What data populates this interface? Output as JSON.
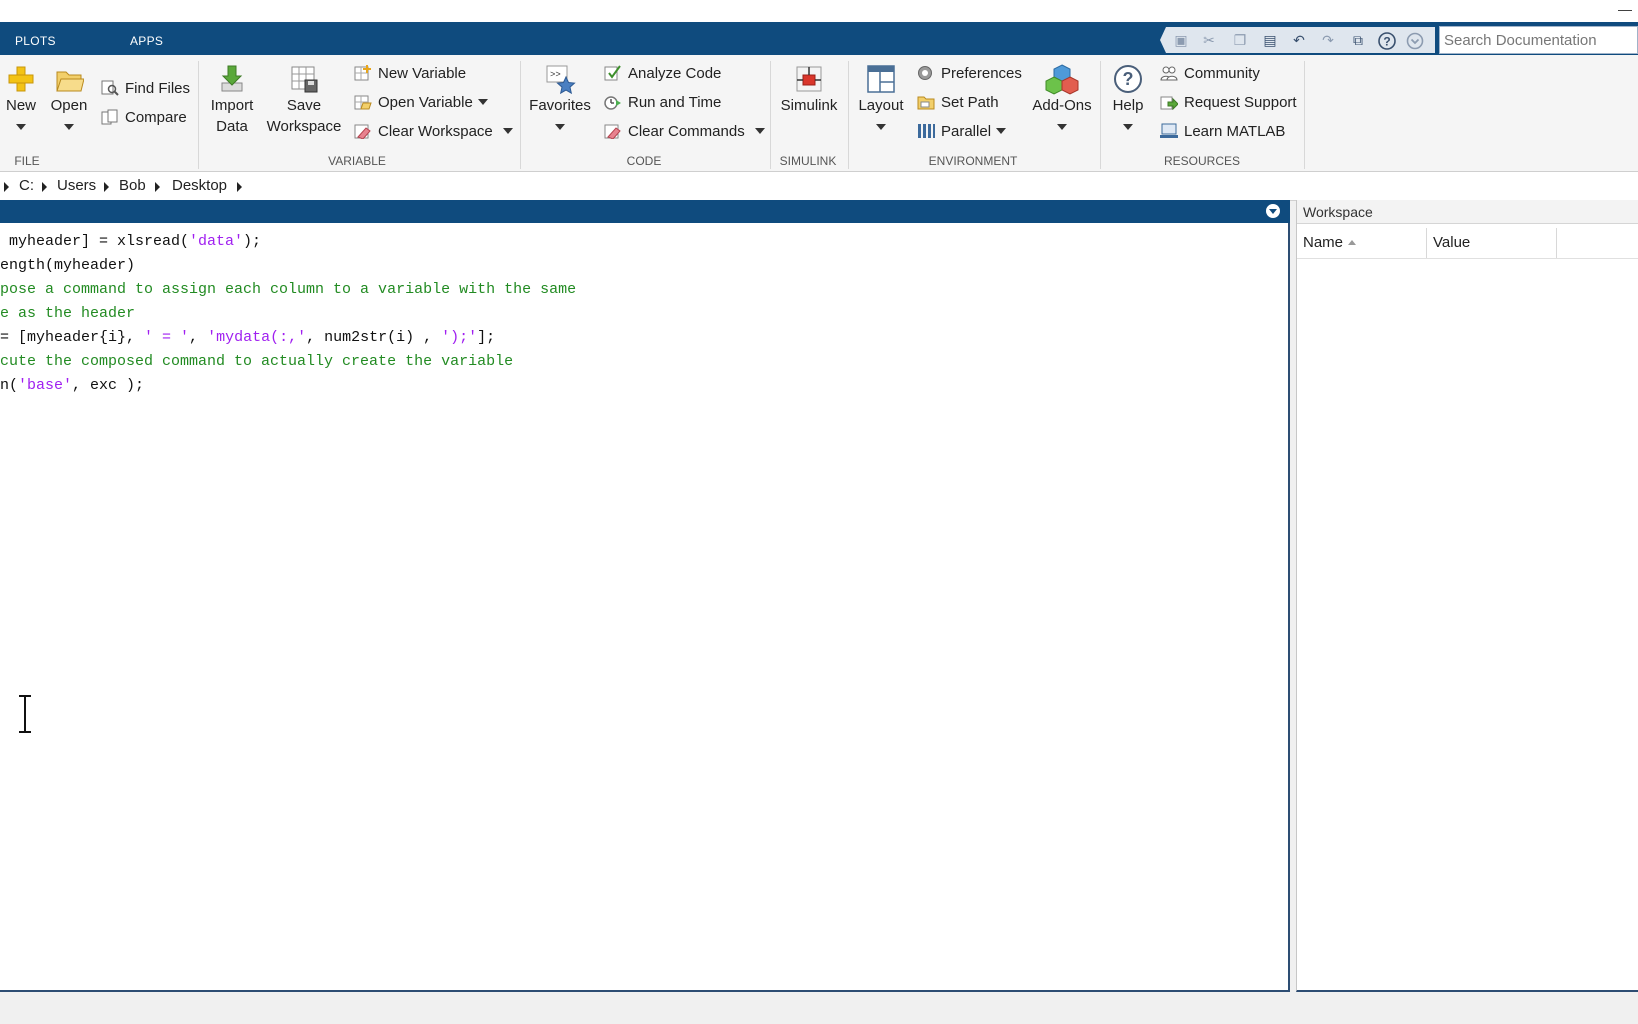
{
  "tabs": {
    "plots": "PLOTS",
    "apps": "APPS"
  },
  "search": {
    "placeholder": "Search Documentation"
  },
  "ribbon": {
    "file": {
      "group_label": "FILE",
      "new": "New",
      "open": "Open",
      "find_files": "Find Files",
      "compare": "Compare"
    },
    "variable": {
      "group_label": "VARIABLE",
      "import_line1": "Import",
      "import_line2": "Data",
      "save_line1": "Save",
      "save_line2": "Workspace",
      "new_variable": "New Variable",
      "open_variable": "Open Variable",
      "clear_workspace": "Clear Workspace"
    },
    "code": {
      "group_label": "CODE",
      "favorites": "Favorites",
      "analyze": "Analyze Code",
      "run_time": "Run and Time",
      "clear_commands": "Clear Commands"
    },
    "simulink": {
      "group_label": "SIMULINK",
      "simulink": "Simulink"
    },
    "environment": {
      "group_label": "ENVIRONMENT",
      "layout": "Layout",
      "preferences": "Preferences",
      "set_path": "Set Path",
      "parallel": "Parallel",
      "addons": "Add-Ons"
    },
    "resources": {
      "group_label": "RESOURCES",
      "help": "Help",
      "community": "Community",
      "request_support": "Request Support",
      "learn": "Learn MATLAB"
    }
  },
  "address": {
    "path": [
      "C:",
      "Users",
      "Bob",
      "Desktop"
    ]
  },
  "command_window": {
    "lines": [
      [
        {
          "t": " myheader] = xlsread("
        },
        {
          "t": "'data'",
          "c": "str"
        },
        {
          "t": ");"
        }
      ],
      [
        {
          "t": "ength(myheader)"
        }
      ],
      [
        {
          "t": "pose a command to assign each column to a variable with the same",
          "c": "cmt"
        }
      ],
      [
        {
          "t": "e as the header",
          "c": "cmt"
        }
      ],
      [
        {
          "t": "= [myheader{i}, "
        },
        {
          "t": "' = '",
          "c": "str"
        },
        {
          "t": ", "
        },
        {
          "t": "'mydata(:,'",
          "c": "str"
        },
        {
          "t": ", num2str(i) , "
        },
        {
          "t": "');'",
          "c": "str"
        },
        {
          "t": "];"
        }
      ],
      [
        {
          "t": "cute the composed command to actually create the variable",
          "c": "cmt"
        }
      ],
      [
        {
          "t": "n("
        },
        {
          "t": "'base'",
          "c": "str"
        },
        {
          "t": ", exc );"
        }
      ]
    ]
  },
  "workspace": {
    "title": "Workspace",
    "columns": {
      "name": "Name",
      "value": "Value"
    }
  }
}
